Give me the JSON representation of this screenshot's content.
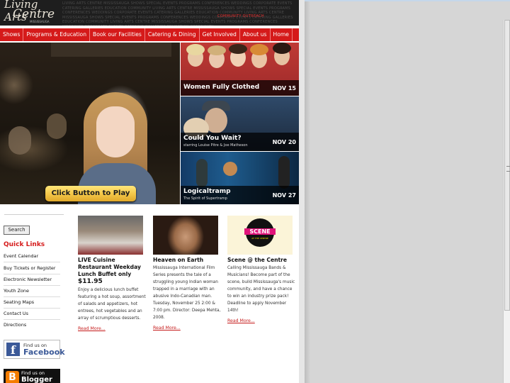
{
  "header": {
    "logo_line1": "Living Arts",
    "logo_line2": "Centre",
    "logo_sub": "MISSISSAUGA",
    "tagline_pattern": "LIVING ARTS CENTRE MISSISSAUGA SHOWS SPECIAL EVENTS PROGRAMS CONFERENCES WEDDINGS CORPORATE EVENTS CATERING GALLERIES EDUCATION COMMUNITY LIVING ARTS CENTRE MISSISSAUGA SHOWS SPECIAL EVENTS PROGRAMS CONFERENCES WEDDINGS CORPORATE EVENTS CATERING GALLERIES EDUCATION COMMUNITY LIVING ARTS CENTRE MISSISSAUGA SHOWS SPECIAL EVENTS PROGRAMS CONFERENCES WEDDINGS CORPORATE EVENTS CATERING GALLERIES EDUCATION COMMUNITY LIVING ARTS CENTRE MISSISSAUGA SHOWS SPECIAL EVENTS PROGRAMS CONFERENCES WEDDINGS CORPORATE EVENTS CATERING GALLERIES EDUCATION COMMUNITY",
    "community_link": "COMMUNITY OUTREACH"
  },
  "nav": {
    "items": [
      "Shows",
      "Programs & Education",
      "Book our Facilities",
      "Catering & Dining",
      "Get Involved",
      "About us",
      "Home"
    ]
  },
  "video": {
    "play_label": "Click Button to Play"
  },
  "promos": [
    {
      "title": "Women Fully Clothed",
      "subtitle": "",
      "date": "NOV 15"
    },
    {
      "title": "Could You Wait?",
      "subtitle": "starring Louise Pitre & Joe Matheson",
      "date": "NOV 20"
    },
    {
      "title": "Logicaltramp",
      "subtitle": "The Spirit of Supertramp",
      "date": "NOV 27"
    }
  ],
  "sidebar": {
    "search_label": "Search",
    "quick_links_title": "Quick Links",
    "links": [
      "Event Calendar",
      "Buy Tickets or Register",
      "Electronic Newsletter",
      "Youth Zone",
      "Seating Maps",
      "Contact Us",
      "Directions"
    ],
    "facebook_line1": "Find us on",
    "facebook_line2": "Facebook",
    "blogger_line1": "Find us on",
    "blogger_line2": "Blogger"
  },
  "features": [
    {
      "title": "LIVE Cuisine Restaurant Weekday Lunch Buffet only",
      "price": "$11.95",
      "body": "Enjoy a delicious lunch buffet featuring a hot soup, assortment of salads and appetizers, hot entrees, hot vegetables and an array of scrumptious desserts.",
      "read_more": "Read More..."
    },
    {
      "title": "Heaven on Earth",
      "price": "",
      "body": "Mississauga International Film Series presents the tale of a struggling young Indian woman trapped in a marriage with an abusive Indo-Canadian man. Tuesday, November 25 2:00 & 7:00 pm. Director: Deepa Mehta, 2008.",
      "read_more": "Read More..."
    },
    {
      "title": "Scene @ the Centre",
      "price": "",
      "body": "Calling Mississauga Bands & Musicians! Become part of the scene, build Mississauga's music community, and have a chance to win an industry prize pack! Deadline to apply November 14th!",
      "read_more": "Read More..."
    }
  ],
  "scene_logo_top": "SCENE",
  "scene_logo_bottom": "AT THE CENTRE"
}
